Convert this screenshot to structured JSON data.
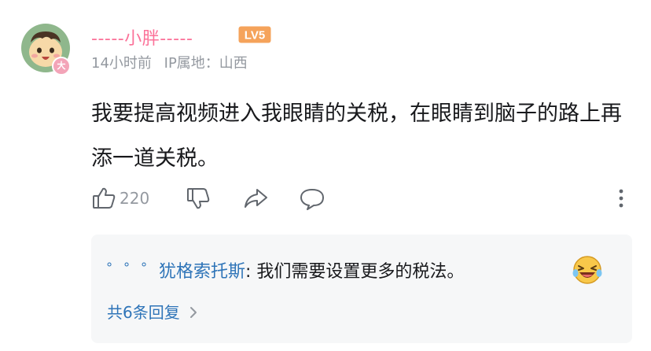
{
  "comment": {
    "username": "-----小胖-----",
    "level": "LV5",
    "avatar_badge": "大",
    "time": "14小时前",
    "ip_location": "IP属地：山西",
    "text": "我要提高视频进入我眼睛的关税，在眼睛到脑子的路上再添一道关税。",
    "like_count": "220"
  },
  "icons": [
    "like-icon",
    "dislike-icon",
    "share-icon",
    "comment-icon",
    "more-icon",
    "chevron-right-icon"
  ],
  "reply_preview": {
    "username": "゜゜゜犹格索托斯",
    "separator": ":",
    "text": " 我们需要设置更多的税法。",
    "emoji": "laughing-crying-emoji",
    "more_label": "共6条回复"
  },
  "colors": {
    "username": "#fb7299",
    "link": "#2e74b8",
    "secondary_text": "#9499a0",
    "reply_bg": "#f6f7f8",
    "level_badge": "#f5a35b"
  }
}
